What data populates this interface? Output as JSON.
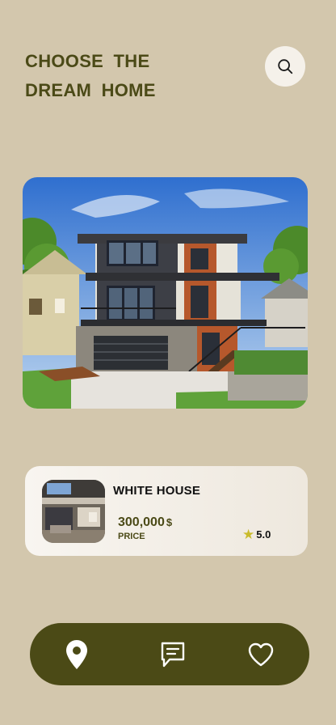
{
  "header": {
    "title_line1": "CHOOSE THE",
    "title_line2": "DREAM HOME",
    "search_icon": "search-icon"
  },
  "hero": {
    "image": "modern-house-photo"
  },
  "property_card": {
    "name": "WHITE HOUSE",
    "price": "300,000",
    "currency": "$",
    "price_label": "PRICE",
    "rating": "5.0",
    "rating_icon": "star-icon"
  },
  "bottom_nav": {
    "items": [
      {
        "icon": "location-pin-icon"
      },
      {
        "icon": "chat-icon"
      },
      {
        "icon": "heart-icon"
      }
    ]
  },
  "colors": {
    "background": "#d3c7ad",
    "accent": "#4b4a16",
    "card": "#f8f5f0",
    "star": "#c9bb2c"
  }
}
